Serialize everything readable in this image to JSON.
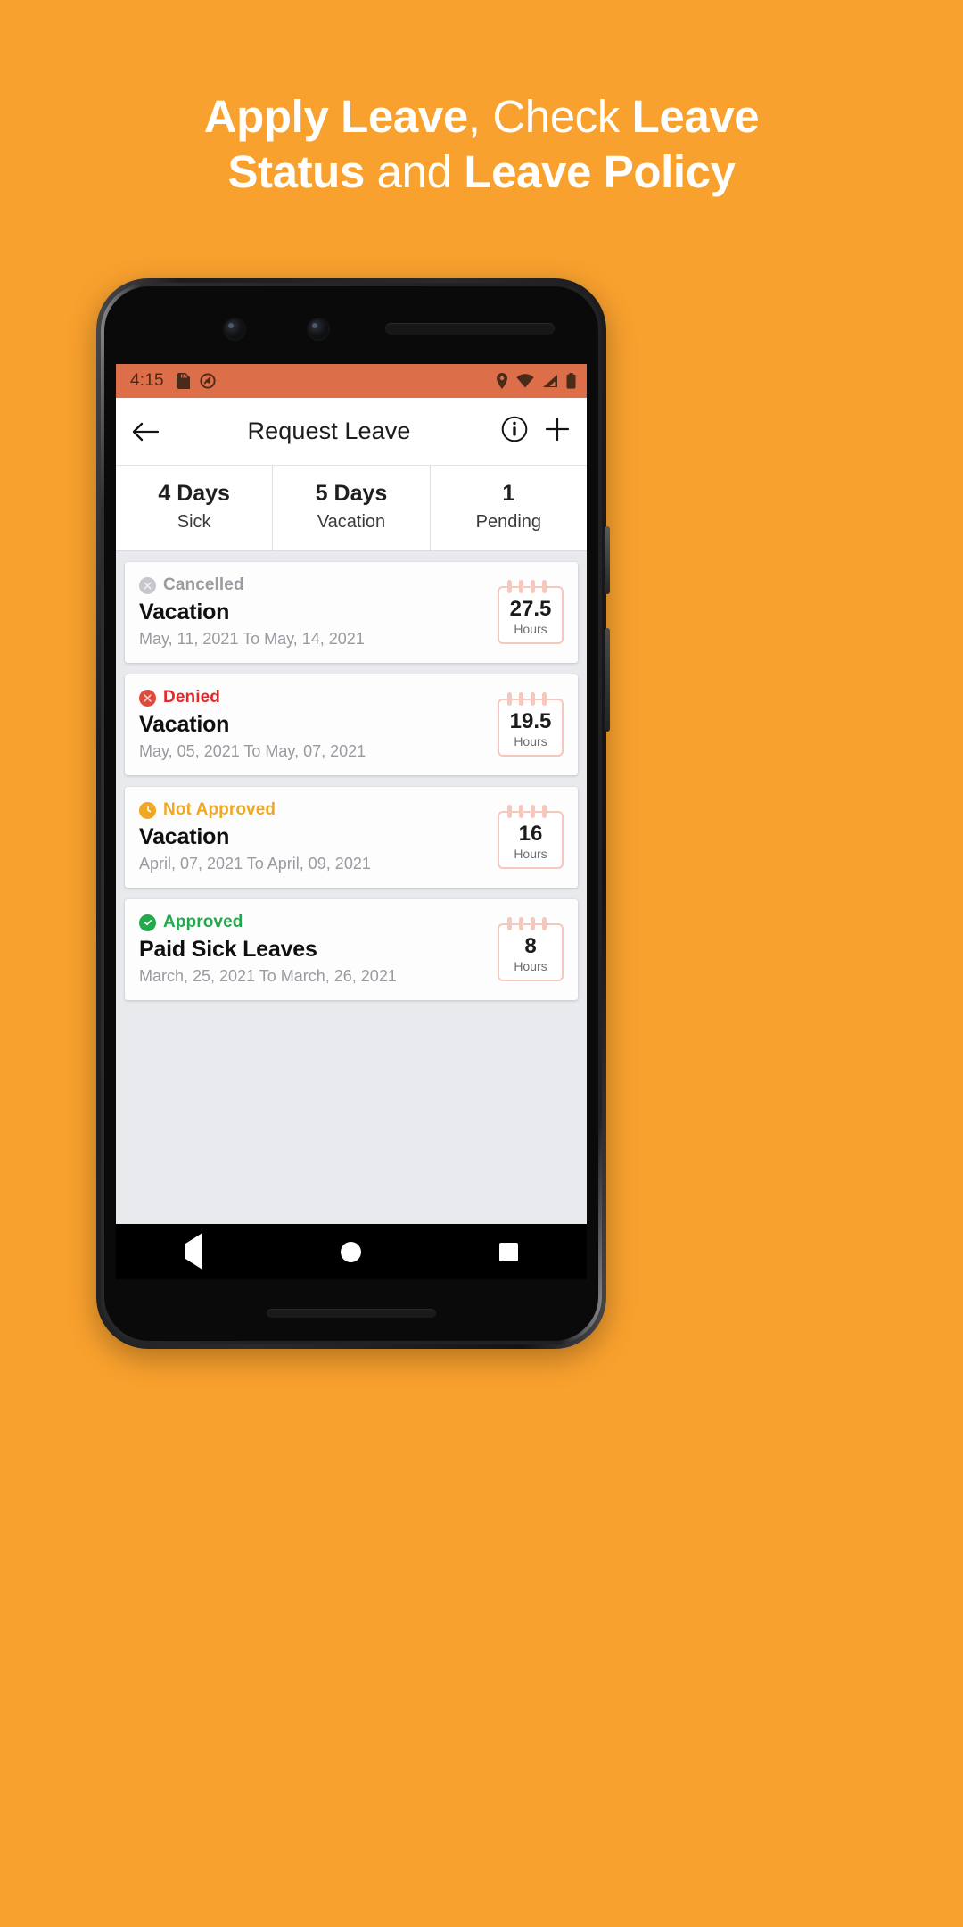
{
  "promo": {
    "line1_bold_a": "Apply Leave",
    "line1_rest": ", Check ",
    "line1_bold_b": "Leave",
    "line2_bold_a": "Status",
    "line2_rest": " and ",
    "line2_bold_b": "Leave Policy",
    "background_color": "#F9A12E",
    "text_color": "#FFFFFF"
  },
  "statusbar": {
    "time": "4:15",
    "background_color": "#DD6E4A",
    "icons": [
      "sd-card-icon",
      "silent-mode-icon",
      "location-icon",
      "wifi-icon",
      "signal-icon",
      "battery-icon"
    ]
  },
  "toolbar": {
    "back_icon": "back-arrow-icon",
    "title": "Request Leave",
    "info_icon": "info-icon",
    "add_icon": "plus-icon"
  },
  "stats": [
    {
      "value": "4 Days",
      "label": "Sick"
    },
    {
      "value": "5 Days",
      "label": "Vacation"
    },
    {
      "value": "1",
      "label": "Pending"
    }
  ],
  "leaves": [
    {
      "status": "Cancelled",
      "status_color": "#A2A2A8",
      "status_icon": "cancel-circle-icon",
      "title": "Vacation",
      "dates": "May, 11, 2021 To May, 14, 2021",
      "hours": "27.5",
      "hours_unit": "Hours"
    },
    {
      "status": "Denied",
      "status_color": "#E8272A",
      "status_icon": "deny-circle-icon",
      "title": "Vacation",
      "dates": "May, 05, 2021 To May, 07, 2021",
      "hours": "19.5",
      "hours_unit": "Hours"
    },
    {
      "status": "Not Approved",
      "status_color": "#F0A824",
      "status_icon": "clock-circle-icon",
      "title": "Vacation",
      "dates": "April, 07, 2021 To April, 09, 2021",
      "hours": "16",
      "hours_unit": "Hours"
    },
    {
      "status": "Approved",
      "status_color": "#22A94B",
      "status_icon": "check-circle-icon",
      "title": "Paid Sick Leaves",
      "dates": "March, 25, 2021 To March, 26, 2021",
      "hours": "8",
      "hours_unit": "Hours"
    }
  ],
  "navbar": {
    "back": "nav-back-triangle-icon",
    "home": "nav-home-circle-icon",
    "recents": "nav-recents-square-icon"
  }
}
